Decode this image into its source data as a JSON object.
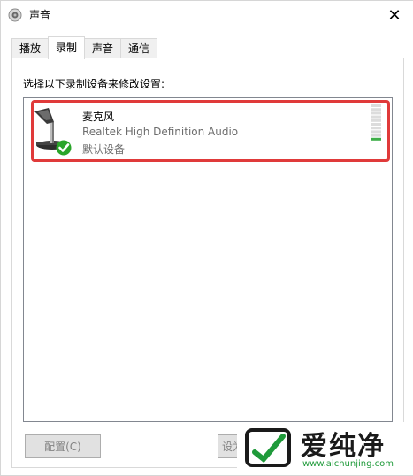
{
  "window": {
    "title": "声音"
  },
  "tabs": [
    {
      "label": "播放",
      "active": false
    },
    {
      "label": "录制",
      "active": true
    },
    {
      "label": "声音",
      "active": false
    },
    {
      "label": "通信",
      "active": false
    }
  ],
  "panel": {
    "instruction": "选择以下录制设备来修改设置:"
  },
  "device": {
    "name": "麦克风",
    "driver": "Realtek High Definition Audio",
    "status": "默认设备",
    "level_fraction": 0.0
  },
  "buttons": {
    "configure": "配置(C)",
    "set_default": "设为"
  },
  "watermark": {
    "text": "爱纯净",
    "url": "www.aichunjing.com"
  },
  "colors": {
    "highlight": "#e03a3a",
    "accent_green": "#2aa52a",
    "meter_green": "#3fae49"
  }
}
